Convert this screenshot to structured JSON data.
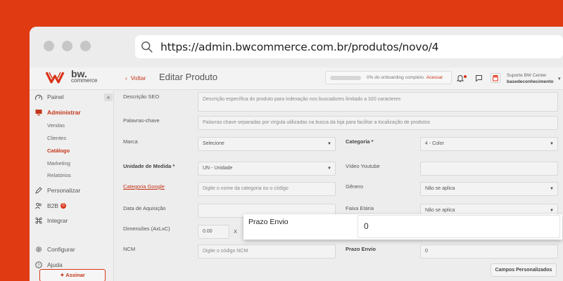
{
  "browser": {
    "url": "https://admin.bwcommerce.com.br/produtos/novo/4"
  },
  "topbar": {
    "logo_line1": "bw.",
    "logo_line2": "commerce",
    "back_label": "Voltar",
    "page_title": "Editar Produto",
    "onboarding_text": "0% do onboarding completo.",
    "onboarding_link": "Acessar",
    "onboarding_progress": 0,
    "user_name": "Suporte BW Center",
    "user_store": "basedeconhecimento"
  },
  "sidebar": {
    "collapse_label": "«",
    "items": {
      "painel": "Painel",
      "administrar": "Administrar",
      "vendas": "Vendas",
      "clientes": "Clientes",
      "catalogo": "Catálogo",
      "marketing": "Marketing",
      "relatorios": "Relatórios",
      "personalizar": "Personalizar",
      "b2b": "B2B",
      "integrar": "Integrar",
      "configurar": "Configurar",
      "ajuda": "Ajuda"
    },
    "b2b_badge": "0",
    "assinar_label": "Assinar"
  },
  "form": {
    "descricao_seo_label": "Descrição SEO",
    "descricao_seo_placeholder": "Descrição específica do produto para indexação nos buscadores limitado a 320 caracteres",
    "palavras_chave_label": "Palavras-chave",
    "palavras_chave_placeholder": "Palavras chave separadas por vírgula utilizadas na busca da loja para facilitar a localização de produtos",
    "marca_label": "Marca",
    "marca_value": "Selecione",
    "categoria_label": "Categoria *",
    "categoria_value": "4 - Color",
    "unidade_label": "Unidade de Medida *",
    "unidade_value": "UN - Unidade",
    "video_label": "Vídeo Youtube",
    "categoria_google_label": "Categoria Google",
    "categoria_google_placeholder": "Digite o nome da categoria ou o código",
    "genero_label": "Gênero",
    "genero_value": "Não se aplica",
    "data_aquisicao_label": "Data de Aquisição",
    "faixa_etaria_label": "Faixa Etária",
    "faixa_etaria_value": "Não se aplica",
    "dimensoes_label": "Dimensões (AxLxC)",
    "dimensoes_value": "0.00",
    "dimensoes_sep": "X",
    "ncm_label": "NCM",
    "ncm_placeholder": "Digite o código NCM",
    "prazo_envio_label": "Prazo Envio",
    "prazo_envio_value": "0",
    "campos_button": "Campos Personalizados"
  },
  "highlight": {
    "label": "Prazo Envio",
    "value": "0"
  },
  "colors": {
    "brand": "#e03a12",
    "accent": "#c4351a"
  }
}
